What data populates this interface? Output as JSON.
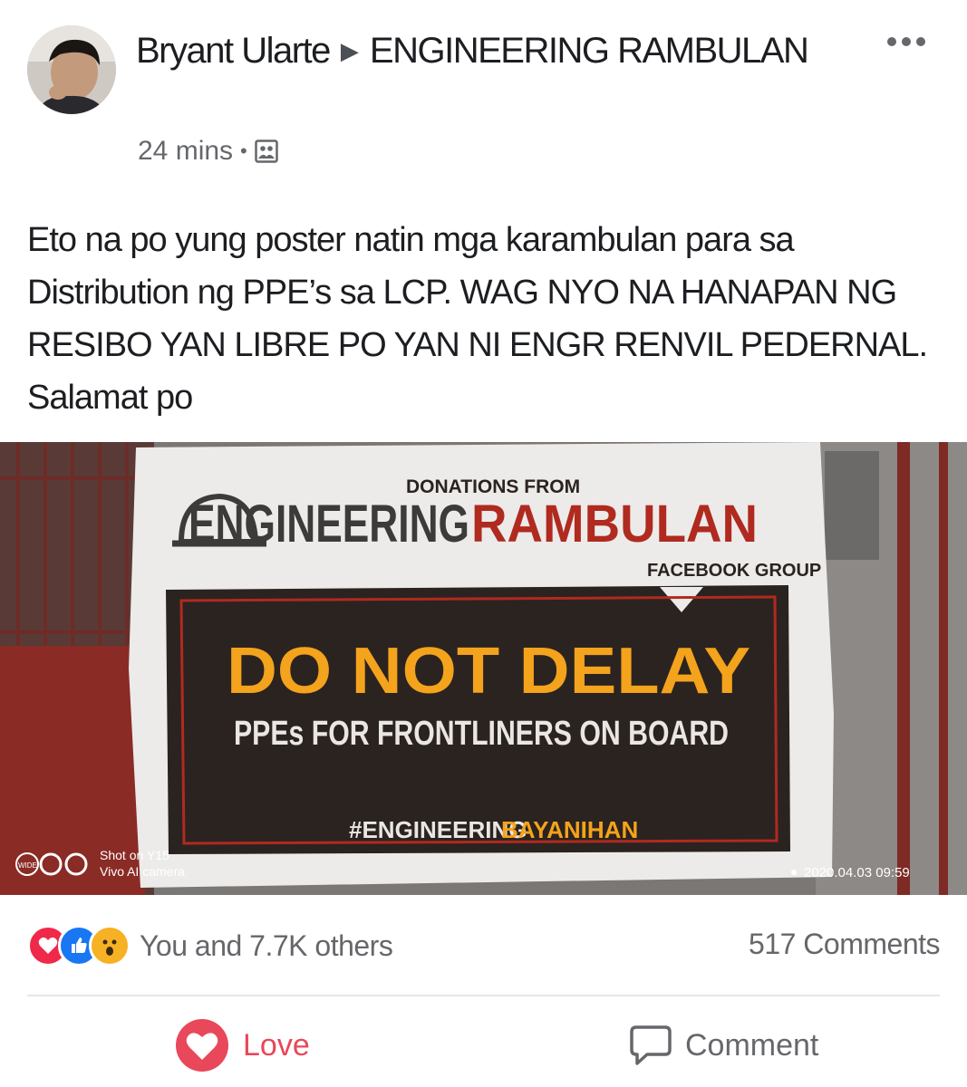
{
  "post": {
    "author": "Bryant Ularte",
    "group": "ENGINEERING RAMBULAN",
    "time": "24 mins",
    "dot": "•",
    "text": "Eto na po yung poster natin mga karambulan para sa Distribution ng PPE’s sa LCP. WAG NYO NA HANAPAN NG RESIBO YAN LIBRE PO YAN NI ENGR RENVIL PEDERNAL. Salamat po",
    "privacy_icon": "group-photo-icon",
    "more_icon": "more-dots-icon"
  },
  "photo": {
    "banner_top": "DONATIONS FROM",
    "banner_brand_a": "ENGINEERING",
    "banner_brand_b": "RAMBULAN",
    "banner_group": "FACEBOOK GROUP",
    "headline": "DO NOT DELAY",
    "subline": "PPEs FOR FRONTLINERS ON BOARD",
    "hashtag_a": "#ENGINEERING",
    "hashtag_b": "BAYANIHAN",
    "watermark_mode": "WIDE",
    "watermark_line1": "Shot on Y15",
    "watermark_line2": "Vivo AI camera",
    "timestamp": "2020.04.03 09:59",
    "colors": {
      "banner_red": "#b02a1f",
      "banner_orange": "#f4a31c",
      "banner_dark": "#2b2320"
    }
  },
  "footer": {
    "reaction_icons": [
      "love-reaction-icon",
      "like-reaction-icon",
      "wow-reaction-icon"
    ],
    "reaction_text": "You and 7.7K others",
    "comments_count": "517 Comments",
    "love_label": "Love",
    "comment_label": "Comment",
    "love_color": "#e8485a"
  }
}
